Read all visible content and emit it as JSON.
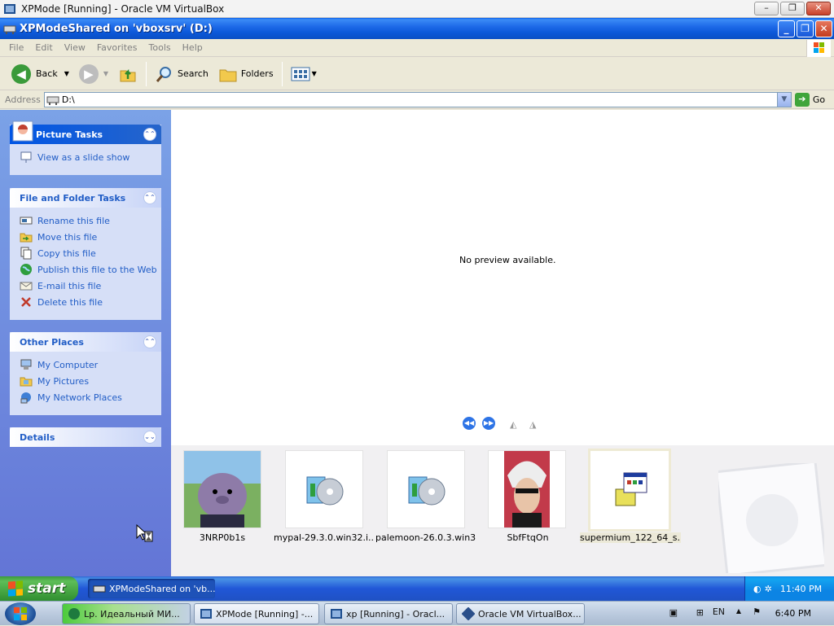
{
  "host_window": {
    "title": "XPMode [Running] - Oracle VM VirtualBox",
    "buttons": [
      "minimize",
      "restore",
      "close"
    ]
  },
  "explorer": {
    "title": "XPModeShared on 'vboxsrv' (D:)",
    "menu": [
      "File",
      "Edit",
      "View",
      "Favorites",
      "Tools",
      "Help"
    ],
    "toolbar": {
      "back_label": "Back",
      "search_label": "Search",
      "folders_label": "Folders"
    },
    "address": {
      "label": "Address",
      "value": "D:\\",
      "go_label": "Go"
    },
    "task_pane": {
      "picture_tasks": {
        "title": "Picture Tasks",
        "items": [
          {
            "label": "View as a slide show",
            "icon": "slideshow-icon"
          }
        ]
      },
      "file_tasks": {
        "title": "File and Folder Tasks",
        "items": [
          {
            "label": "Rename this file",
            "icon": "rename-icon"
          },
          {
            "label": "Move this file",
            "icon": "move-icon"
          },
          {
            "label": "Copy this file",
            "icon": "copy-icon"
          },
          {
            "label": "Publish this file to the Web",
            "icon": "globe-icon"
          },
          {
            "label": "E-mail this file",
            "icon": "email-icon"
          },
          {
            "label": "Delete this file",
            "icon": "delete-icon"
          }
        ]
      },
      "other_places": {
        "title": "Other Places",
        "items": [
          {
            "label": "My Computer",
            "icon": "computer-icon"
          },
          {
            "label": "My Pictures",
            "icon": "pictures-folder-icon"
          },
          {
            "label": "My Network Places",
            "icon": "network-icon"
          }
        ]
      },
      "details": {
        "title": "Details"
      }
    },
    "preview": {
      "message": "No preview available."
    },
    "files": [
      {
        "name": "3NRP0b1s",
        "kind": "image-cartoon"
      },
      {
        "name": "mypal-29.3.0.win32.i...",
        "kind": "installer"
      },
      {
        "name": "palemoon-26.0.3.win3...",
        "kind": "installer"
      },
      {
        "name": "SbfFtqOn",
        "kind": "image-photo"
      },
      {
        "name": "supermium_122_64_s...",
        "kind": "setup-exe",
        "selected": true
      }
    ]
  },
  "guest_taskbar": {
    "start_label": "start",
    "task_label": "XPModeShared on 'vb...",
    "clock": "11:40 PM"
  },
  "host_taskbar": {
    "tasks": [
      "Lp. Идеальный МИ...",
      "XPMode [Running] -...",
      "xp [Running] - Oracl...",
      "Oracle VM VirtualBox..."
    ],
    "language": "EN",
    "clock": "6:40 PM"
  }
}
